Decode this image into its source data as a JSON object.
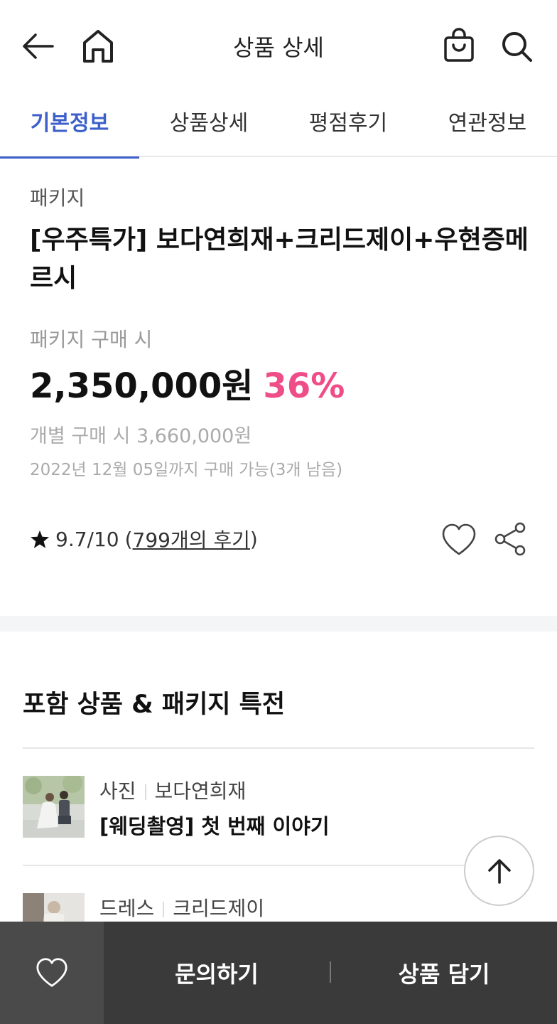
{
  "header": {
    "title": "상품 상세",
    "icons": [
      "back-arrow-icon",
      "home-icon",
      "shopping-bag-icon",
      "search-icon"
    ]
  },
  "tabs": [
    {
      "label": "기본정보",
      "active": true
    },
    {
      "label": "상품상세",
      "active": false
    },
    {
      "label": "평점후기",
      "active": false
    },
    {
      "label": "연관정보",
      "active": false
    }
  ],
  "product": {
    "category": "패키지",
    "title": "[우주특가] 보다연희재+크리드제이+우현증메르시",
    "price_label": "패키지 구매 시",
    "price": "2,350,000원",
    "discount": "36%",
    "original_price": "개별 구매 시 3,660,000원",
    "deadline": "2022년 12월 05일까지 구매 가능(3개 남음)",
    "rating": "9.7/10",
    "rating_open": "(",
    "reviews": "799개의 후기",
    "rating_close": ")"
  },
  "section": {
    "title": "포함 상품 & 패키지 특전",
    "items": [
      {
        "type": "사진",
        "vendor": "보다연희재",
        "name": "[웨딩촬영] 첫 번째 이야기"
      },
      {
        "type": "드레스",
        "vendor": "크리드제이",
        "name": ""
      }
    ]
  },
  "bottom_bar": {
    "inquiry": "문의하기",
    "add_to_cart": "상품 담기"
  },
  "colors": {
    "accent": "#3c5fc9",
    "discount": "#ef4d87",
    "bottom_bar": "#3a3a3a"
  }
}
